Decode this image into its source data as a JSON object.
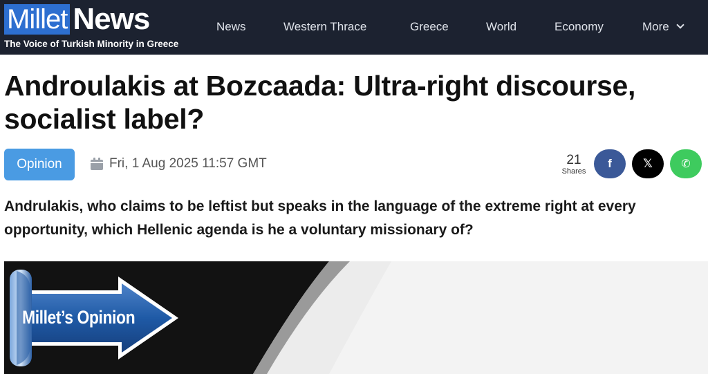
{
  "header": {
    "logo_part1": "Millet",
    "logo_part2": "News",
    "tagline": "The Voice of Turkish Minority in Greece",
    "nav": [
      "News",
      "Western Thrace",
      "Greece",
      "World",
      "Economy",
      "More"
    ]
  },
  "article": {
    "title": "Androulakis at Bozcaada: Ultra-right discourse, socialist label?",
    "category": "Opinion",
    "date": "Fri, 1 Aug 2025 11:57 GMT",
    "share_count": "21",
    "share_label": "Shares",
    "lead": "Andrulakis, who claims to be leftist but speaks in the language of the extreme right at every opportunity, which Hellenic agenda is he a voluntary missionary of?",
    "image_banner_text": "Millet’s Opinion"
  },
  "share_buttons": [
    {
      "name": "facebook",
      "glyph": "f",
      "color": "#3b5998"
    },
    {
      "name": "x",
      "glyph": "𝕏",
      "color": "#000000"
    },
    {
      "name": "whatsapp",
      "glyph": "✆",
      "color": "#3ecb5e"
    }
  ],
  "colors": {
    "header_bg": "#1c2230",
    "logo_blue": "#2d6fd0",
    "badge_blue": "#4a9be3"
  },
  "icons": {
    "date": "calendar-icon",
    "more": "chevron-down-icon"
  }
}
